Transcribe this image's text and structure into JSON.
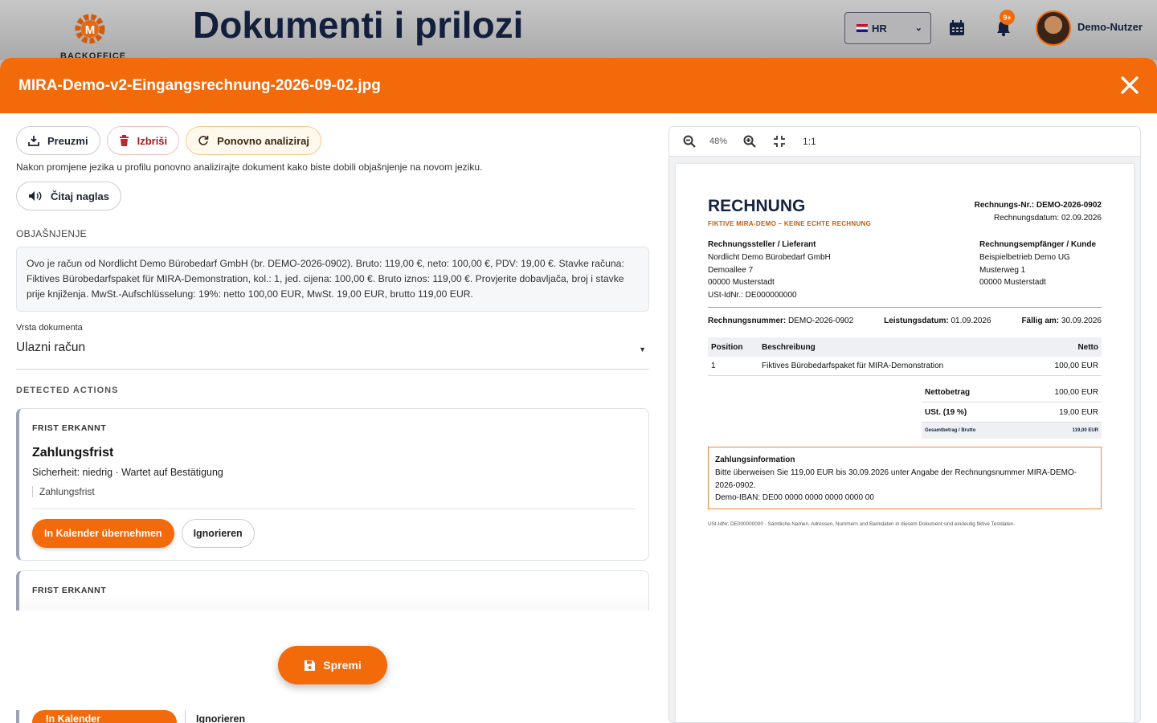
{
  "background": {
    "logo_text": "BACKOFFICE",
    "page_title": "Dokumenti i prilozi",
    "language": "HR",
    "notification_badge": "9+",
    "user_name": "Demo-Nutzer"
  },
  "modal": {
    "title": "MIRA-Demo-v2-Eingangsrechnung-2026-09-02.jpg",
    "buttons": {
      "download": "Preuzmi",
      "delete": "Izbriši",
      "reanalyze": "Ponovno analiziraj",
      "read_aloud": "Čitaj naglas",
      "save": "Spremi"
    },
    "hint": "Nakon promjene jezika u profilu ponovno analizirajte dokument kako biste dobili objašnjenje na novom jeziku.",
    "explanation_label": "OBJAŠNJENJE",
    "explanation": "Ovo je račun od Nordlicht Demo Bürobedarf GmbH (br. DEMO-2026-0902). Bruto: 119,00 €, neto: 100,00 €, PDV: 19,00 €. Stavke računa: Fiktives Bürobedarfspaket für MIRA-Demonstration, kol.: 1, jed. cijena: 100,00 €. Bruto iznos: 119,00 €. Provjerite dobavljača, broj i stavke prije knjiženja. MwSt.-Aufschlüsselung: 19%: netto 100,00 EUR, MwSt. 19,00 EUR, brutto 119,00 EUR.",
    "doc_type_label": "Vrsta dokumenta",
    "doc_type_value": "Ulazni račun",
    "detected_label": "DETECTED ACTIONS",
    "actions": [
      {
        "kicker": "FRIST ERKANNT",
        "title": "Zahlungsfrist",
        "meta": "Sicherheit: niedrig · Wartet auf Bestätigung",
        "note": "Zahlungsfrist",
        "primary": "In Kalender übernehmen",
        "secondary": "Ignorieren"
      },
      {
        "kicker": "FRIST ERKANNT",
        "primary": "In Kalender übernehmen",
        "secondary": "Ignorieren"
      }
    ]
  },
  "preview": {
    "zoom": "48%",
    "one_to_one": "1:1",
    "invoice": {
      "heading": "RECHNUNG",
      "subheading": "FIKTIVE MIRA-DEMO – KEINE ECHTE RECHNUNG",
      "meta_no_label": "Rechnungs-Nr.:",
      "meta_no": "DEMO-2026-0902",
      "meta_date": "Rechnungsdatum: 02.09.2026",
      "seller_title": "Rechnungssteller / Lieferant",
      "seller_lines": [
        "Nordlicht Demo Bürobedarf GmbH",
        "Demoallee 7",
        "00000 Musterstadt",
        "USt-IdNr.: DE000000000"
      ],
      "buyer_title": "Rechnungsempfänger / Kunde",
      "buyer_lines": [
        "Beispielbetrieb Demo UG",
        "Musterweg 1",
        "00000 Musterstadt"
      ],
      "ref_number_label": "Rechnungsnummer:",
      "ref_number": "DEMO-2026-0902",
      "service_date_label": "Leistungsdatum:",
      "service_date": "01.09.2026",
      "due_label": "Fällig am:",
      "due": "30.09.2026",
      "table_headers": [
        "Position",
        "Beschreibung",
        "Netto"
      ],
      "table_rows": [
        [
          "1",
          "Fiktives Bürobedarfspaket für MIRA-Demonstration",
          "100,00 EUR"
        ]
      ],
      "totals": [
        {
          "label": "Nettobetrag",
          "value": "100,00 EUR"
        },
        {
          "label": "USt. (19 %)",
          "value": "19,00 EUR"
        }
      ],
      "gross_label": "Gesamtbetrag / Brutto",
      "gross_value": "119,00 EUR",
      "payment_title": "Zahlungsinformation",
      "payment_text": "Bitte überweisen Sie 119,00 EUR bis 30.09.2026 unter Angabe der Rechnungsnummer MIRA-DEMO-2026-0902.",
      "payment_iban": "Demo-IBAN: DE00 0000 0000 0000 0000 00",
      "footer": "USt-IdNr. DE000000000 · Sämtliche Namen, Adressen, Nummern und Bankdaten in diesem Dokument sind eindeutig fiktive Testdaten."
    }
  },
  "colors": {
    "accent": "#f26a0a",
    "navy": "#16243f"
  }
}
